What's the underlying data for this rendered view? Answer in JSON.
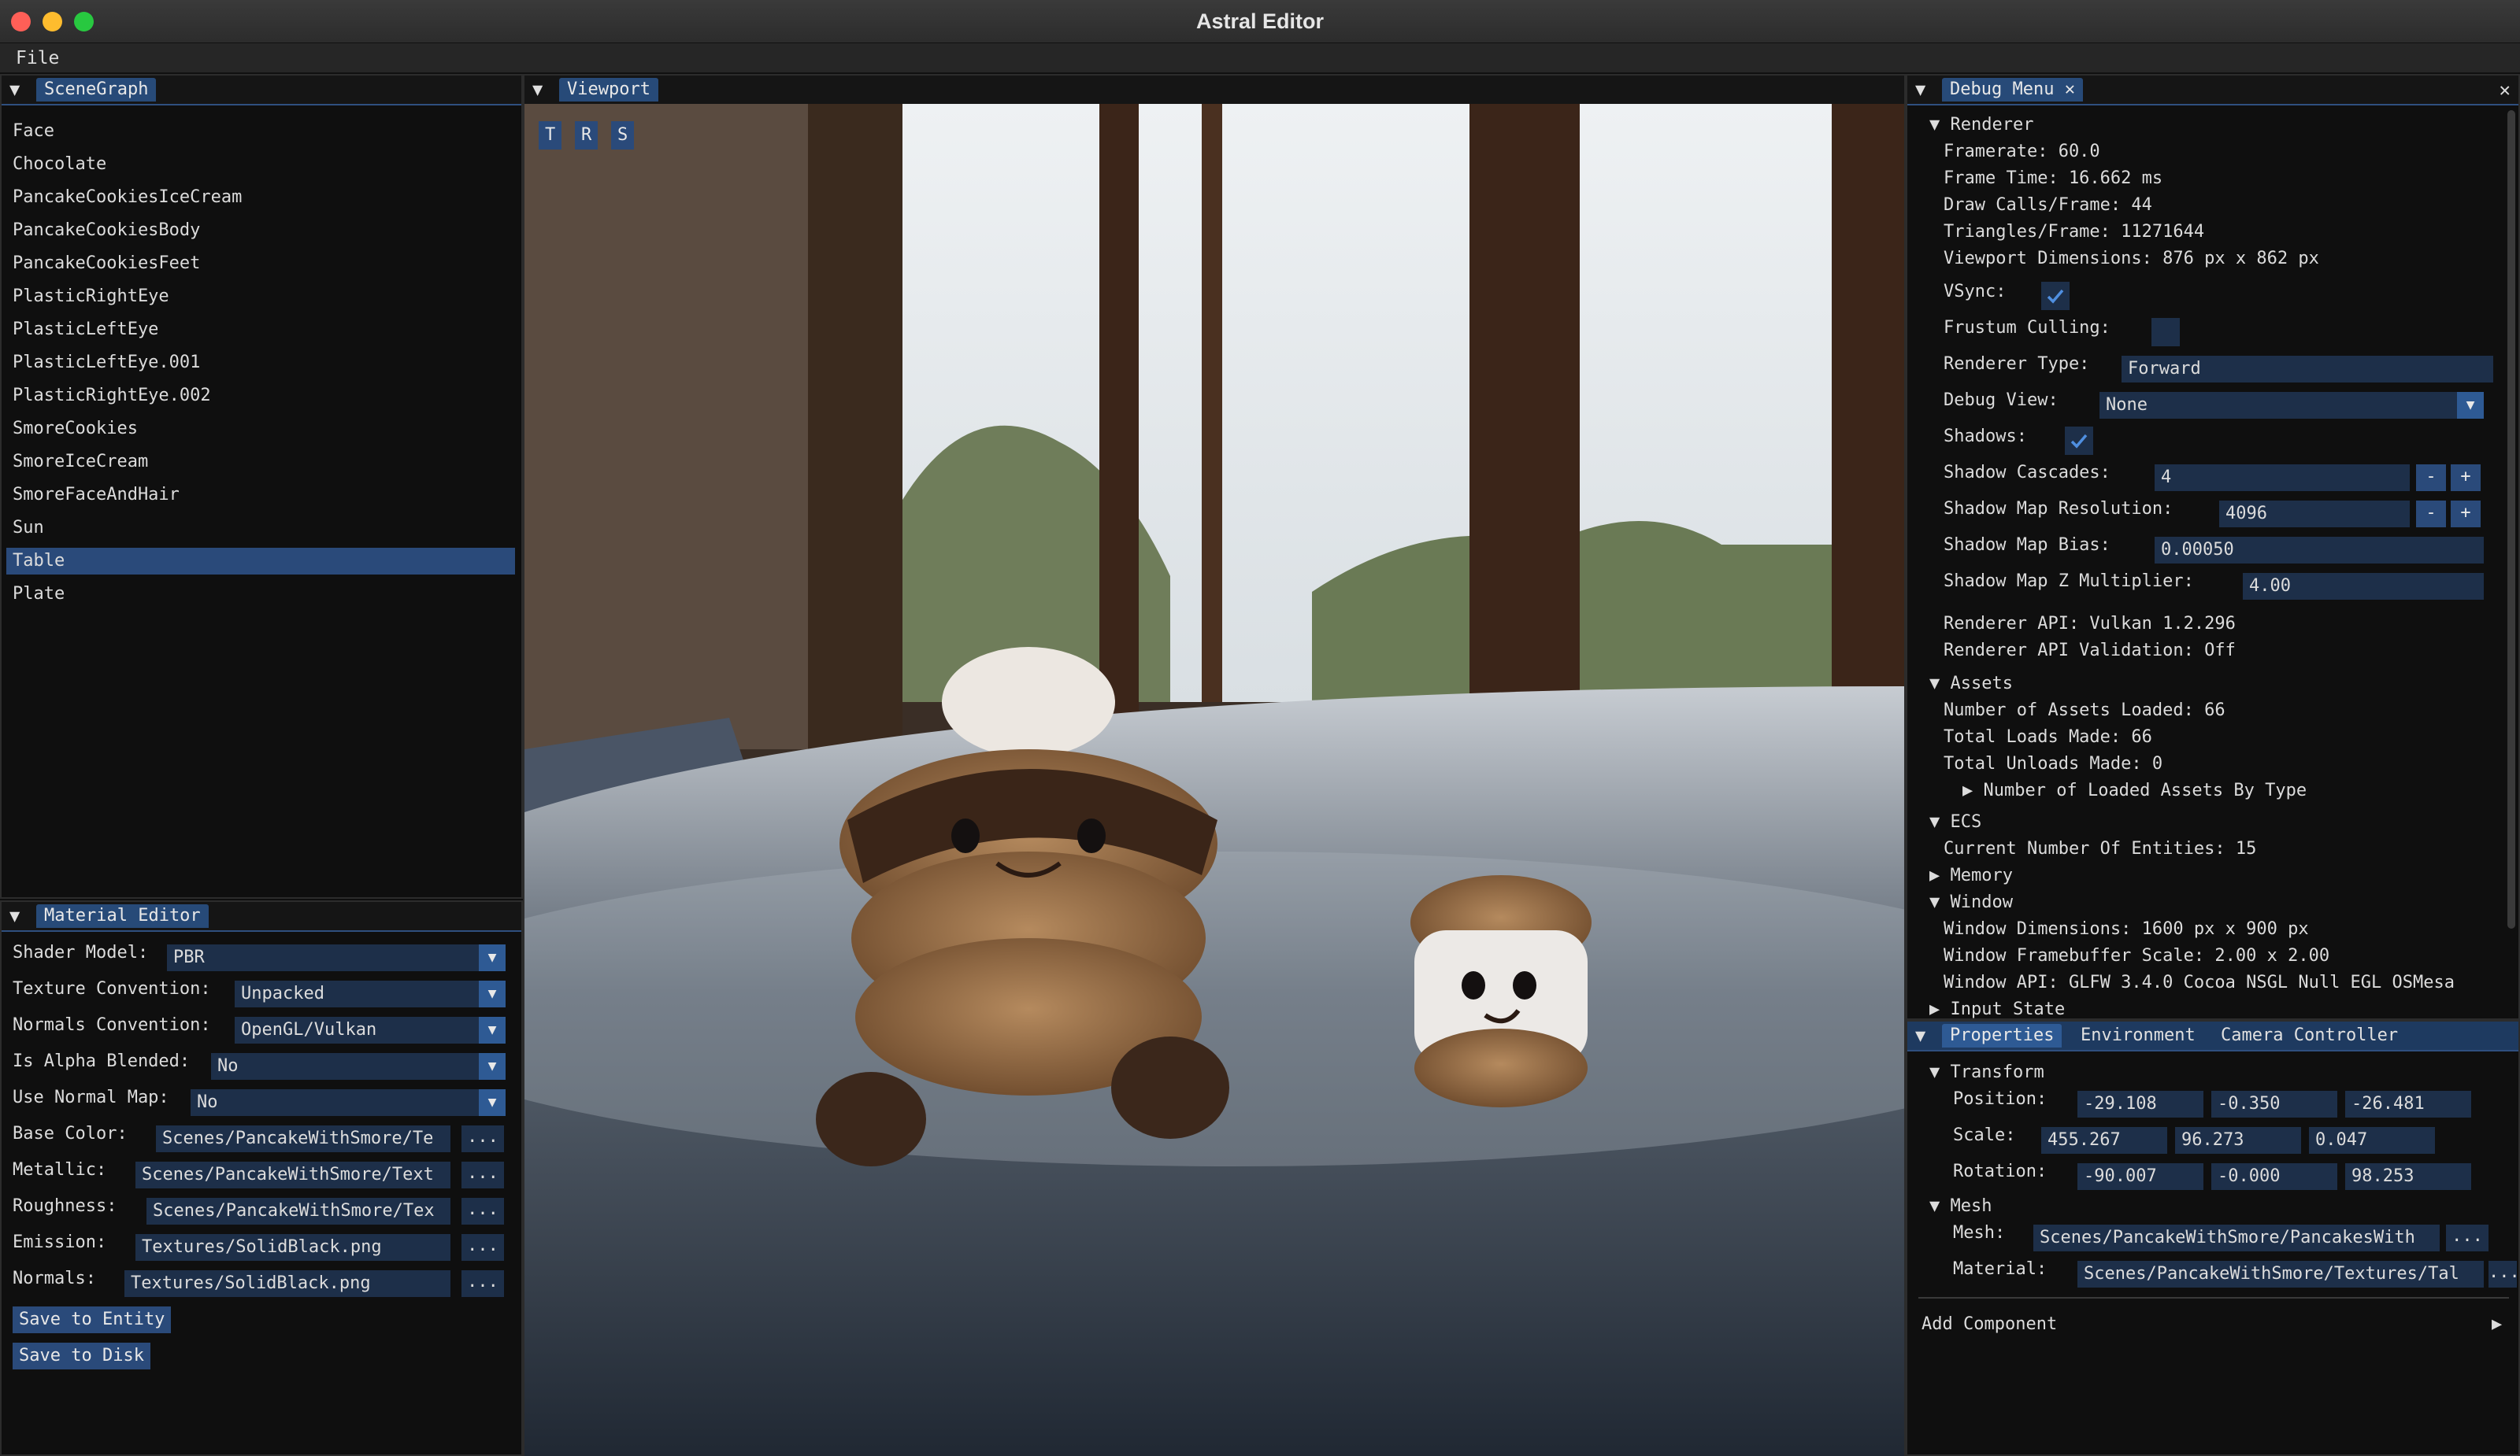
{
  "app": {
    "title": "Astral Editor",
    "menu": [
      "File"
    ]
  },
  "scenegraph": {
    "tab": "SceneGraph",
    "items": [
      "Face",
      "Chocolate",
      "PancakeCookiesIceCream",
      "PancakeCookiesBody",
      "PancakeCookiesFeet",
      "PlasticRightEye",
      "PlasticLeftEye",
      "PlasticLeftEye.001",
      "PlasticRightEye.002",
      "SmoreCookies",
      "SmoreIceCream",
      "SmoreFaceAndHair",
      "Sun",
      "Table",
      "Plate"
    ],
    "selected": "Table"
  },
  "material_editor": {
    "tab": "Material Editor",
    "fields": [
      {
        "label": "Shader Model:",
        "value": "PBR",
        "kind": "dropdown"
      },
      {
        "label": "Texture Convention:",
        "value": "Unpacked",
        "kind": "dropdown"
      },
      {
        "label": "Normals Convention:",
        "value": "OpenGL/Vulkan",
        "kind": "dropdown"
      },
      {
        "label": "Is Alpha Blended:",
        "value": "No",
        "kind": "dropdown"
      },
      {
        "label": "Use Normal Map:",
        "value": "No",
        "kind": "dropdown"
      },
      {
        "label": "Base Color:",
        "value": "Scenes/PancakeWithSmore/Te",
        "kind": "file"
      },
      {
        "label": "Metallic:",
        "value": "Scenes/PancakeWithSmore/Text",
        "kind": "file"
      },
      {
        "label": "Roughness:",
        "value": "Scenes/PancakeWithSmore/Tex",
        "kind": "file"
      },
      {
        "label": "Emission:",
        "value": "Textures/SolidBlack.png",
        "kind": "file"
      },
      {
        "label": "Normals:",
        "value": "Textures/SolidBlack.png",
        "kind": "file"
      }
    ],
    "browse_label": "...",
    "save_entity": "Save to Entity",
    "save_disk": "Save to Disk"
  },
  "viewport": {
    "tab": "Viewport",
    "gizmo_buttons": [
      "T",
      "R",
      "S"
    ]
  },
  "debug_menu": {
    "tab": "Debug Menu",
    "close": "✕",
    "renderer": {
      "header": "Renderer",
      "framerate": "Framerate: 60.0",
      "frame_time": "Frame Time: 16.662 ms",
      "draw_calls": "Draw Calls/Frame: 44",
      "triangles": "Triangles/Frame: 11271644",
      "viewport_dims": "Viewport Dimensions: 876 px x 862 px",
      "vsync_label": "VSync:",
      "vsync": true,
      "frustum_label": "Frustum Culling:",
      "frustum": false,
      "renderer_type_label": "Renderer Type:",
      "renderer_type": "Forward",
      "debug_view_label": "Debug View:",
      "debug_view": "None",
      "shadows_label": "Shadows:",
      "shadows": true,
      "cascades_label": "Shadow Cascades:",
      "cascades": "4",
      "map_res_label": "Shadow Map Resolution:",
      "map_res": "4096",
      "bias_label": "Shadow Map Bias:",
      "bias": "0.00050",
      "zmult_label": "Shadow Map Z Multiplier:",
      "zmult": "4.00",
      "api": "Renderer API: Vulkan 1.2.296",
      "validation": "Renderer API Validation: Off",
      "minus": "-",
      "plus": "+"
    },
    "assets": {
      "header": "Assets",
      "loaded": "Number of Assets Loaded: 66",
      "loads": "Total Loads Made: 66",
      "unloads": "Total Unloads Made: 0",
      "by_type": "Number of Loaded Assets By Type"
    },
    "ecs": {
      "header": "ECS",
      "entities": "Current Number Of Entities: 15"
    },
    "memory": {
      "header": "Memory"
    },
    "window": {
      "header": "Window",
      "dims": "Window Dimensions: 1600 px x 900 px",
      "scale": "Window Framebuffer Scale: 2.00 x 2.00",
      "api": "Window API: GLFW 3.4.0 Cocoa NSGL Null EGL OSMesa"
    },
    "input": {
      "header": "Input State"
    }
  },
  "properties": {
    "tabs": [
      "Properties",
      "Environment",
      "Camera Controller"
    ],
    "transform": {
      "header": "Transform",
      "position_label": "Position:",
      "position": [
        "-29.108",
        "-0.350",
        "-26.481"
      ],
      "scale_label": "Scale:",
      "scale": [
        "455.267",
        "96.273",
        "0.047"
      ],
      "rotation_label": "Rotation:",
      "rotation": [
        "-90.007",
        "-0.000",
        "98.253"
      ]
    },
    "mesh": {
      "header": "Mesh",
      "mesh_label": "Mesh:",
      "mesh": "Scenes/PancakeWithSmore/PancakesWith",
      "material_label": "Material:",
      "material": "Scenes/PancakeWithSmore/Textures/Tal",
      "browse": "..."
    },
    "add_component": "Add Component"
  },
  "colors": {
    "accent": "#2a4a7a",
    "field": "#1d2f49",
    "checkmark": "#4f8fe0"
  }
}
